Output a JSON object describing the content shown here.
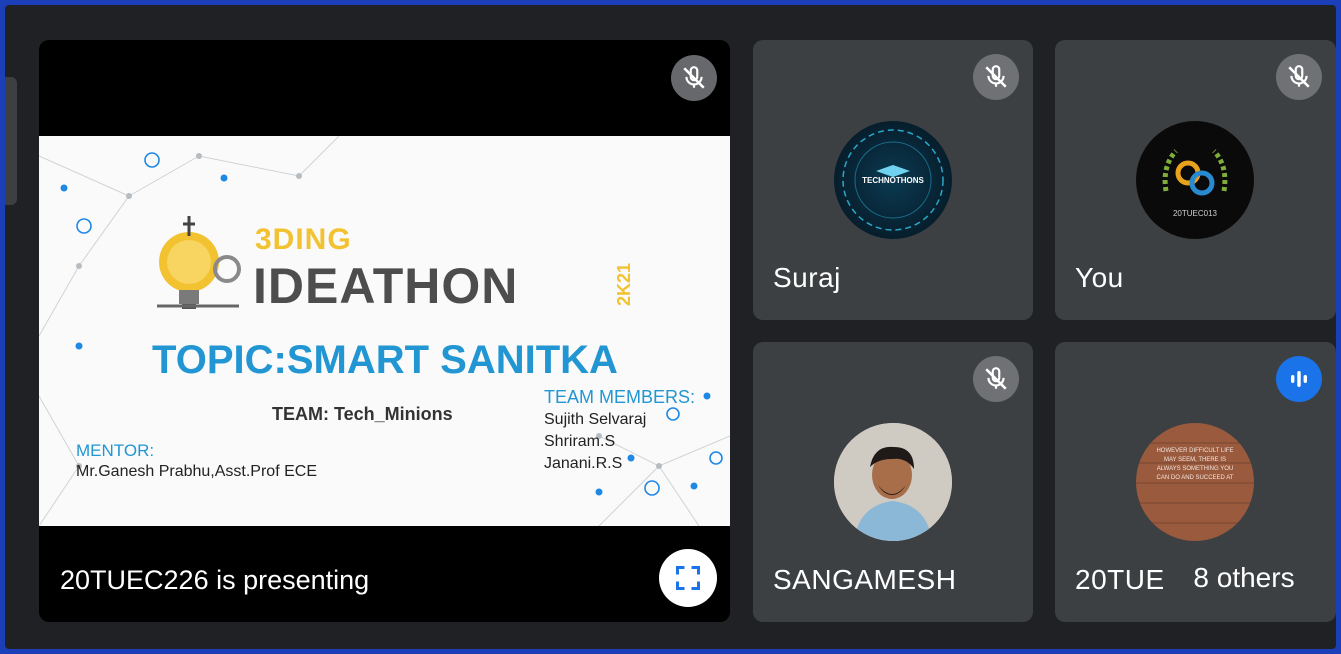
{
  "meeting": {
    "presenting_label": "20TUEC226 is presenting",
    "slide": {
      "brand_top": "3DING",
      "brand_main": "IDEATHON",
      "brand_year": "2K21",
      "topic": "TOPIC:SMART SANITKA",
      "team": "TEAM: Tech_Minions",
      "members_heading": "TEAM MEMBERS:",
      "members": [
        "Sujith Selvaraj",
        "Shriram.S",
        "Janani.R.S"
      ],
      "mentor_heading": "MENTOR:",
      "mentor": "Mr.Ganesh Prabhu,Asst.Prof ECE"
    },
    "participants": [
      {
        "name": "Suraj",
        "muted": true,
        "avatar_text": "TECHNOTHONS"
      },
      {
        "name": "You",
        "muted": true,
        "avatar_text": "20TUEC013"
      },
      {
        "name": "SANGAMESH",
        "muted": true
      },
      {
        "name": "20TUEC226",
        "muted": false,
        "speaking": true,
        "avatar_text": "HOWEVER DIFFICULT LIFE MAY SEEM, THERE IS ALWAYS SOMETHING YOU CAN DO AND SUCCEED AT"
      }
    ],
    "others_count_label": "8 others"
  },
  "colors": {
    "background": "#202124",
    "tile": "#3c4043",
    "border": "#1a3fb8",
    "speaking": "#1a73e8",
    "slide_blue": "#2196d3",
    "slide_yellow": "#f2c230"
  },
  "icons": [
    "mic-off-icon",
    "audio-level-icon",
    "fullscreen-icon"
  ]
}
